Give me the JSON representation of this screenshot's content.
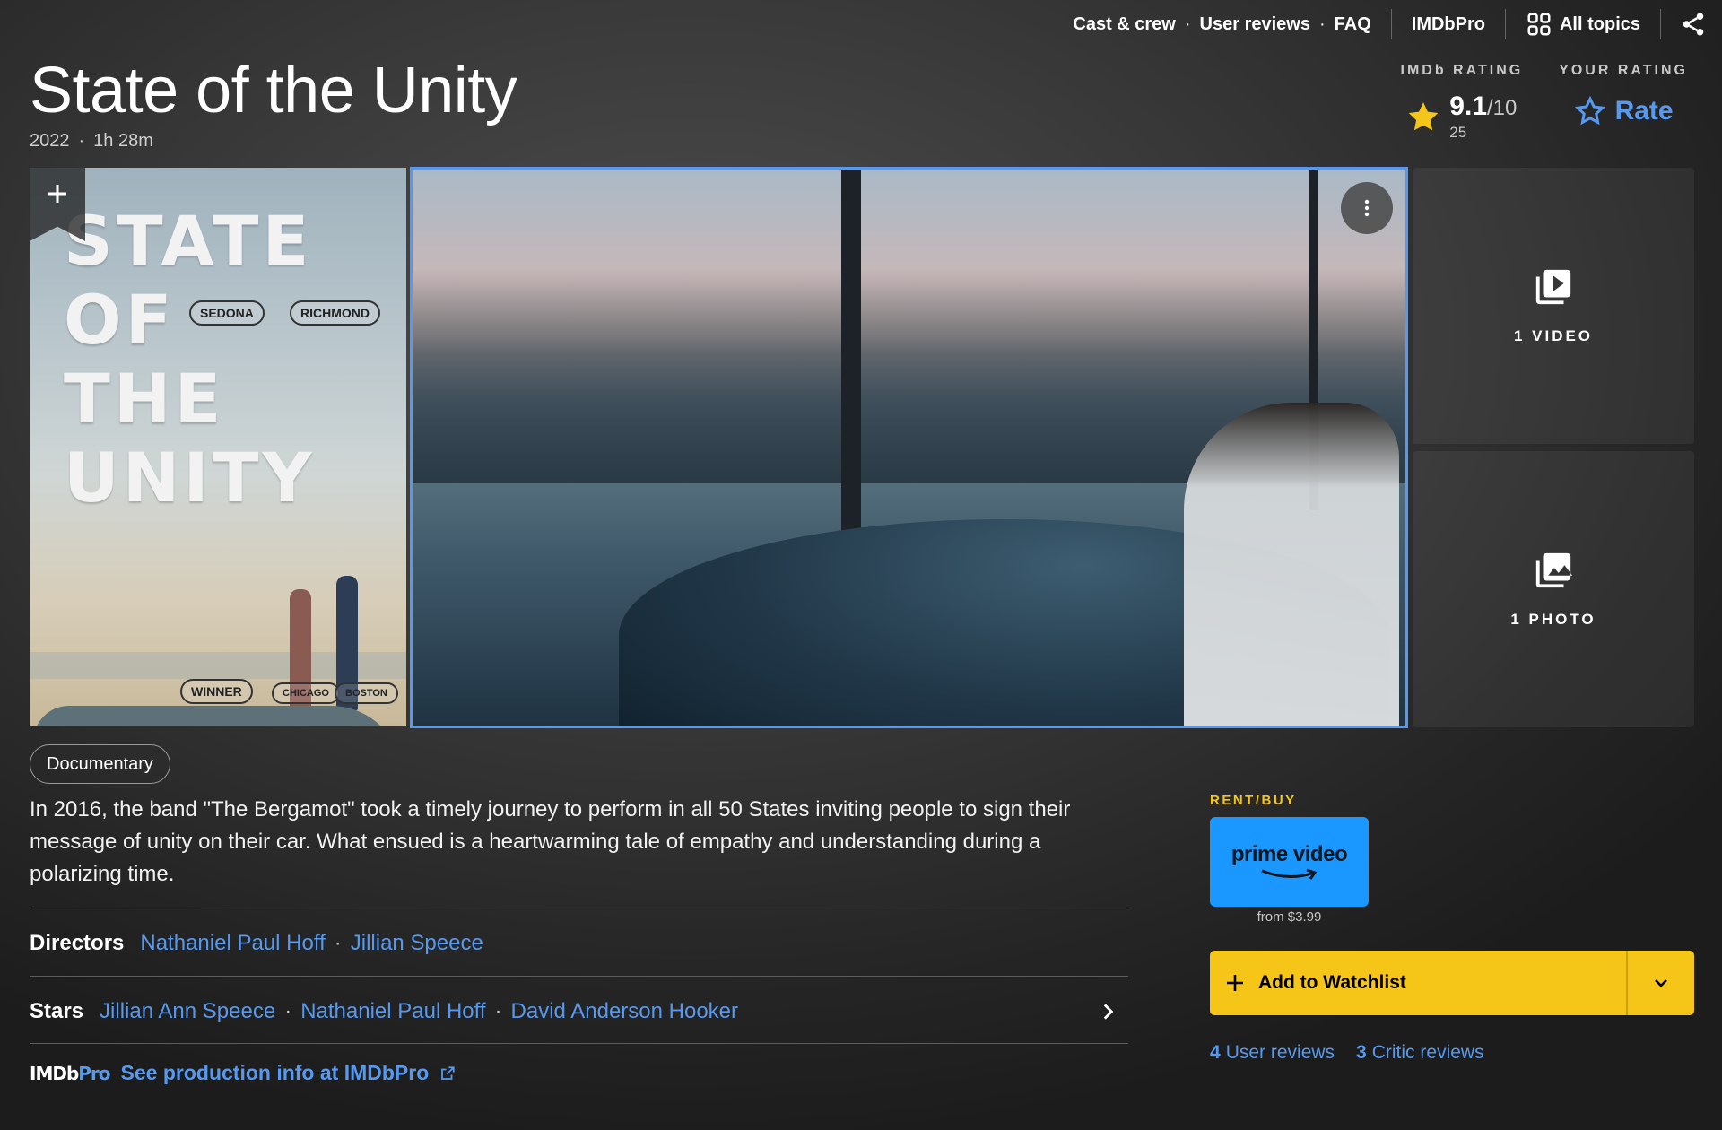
{
  "nav": {
    "cast_crew": "Cast & crew",
    "user_reviews": "User reviews",
    "faq": "FAQ",
    "imdbpro": "IMDbPro",
    "all_topics": "All topics"
  },
  "header": {
    "title": "State of the Unity",
    "year": "2022",
    "runtime": "1h 28m"
  },
  "ratings": {
    "imdb_label": "IMDb RATING",
    "score": "9.1",
    "out_of": "/10",
    "vote_count": "25",
    "your_label": "YOUR RATING",
    "rate_label": "Rate"
  },
  "poster": {
    "title_art": "STATE OF\nTHE\nUNITY",
    "laurel_1": "SEDONA",
    "laurel_2": "RICHMOND",
    "laurel_3": "WINNER",
    "laurel_4": "CHICAGO",
    "laurel_5": "BOSTON"
  },
  "tiles": {
    "videos": "1 VIDEO",
    "photos": "1 PHOTO"
  },
  "details": {
    "genre": "Documentary",
    "plot": "In 2016, the band \"The Bergamot\" took a timely journey to perform in all 50 States inviting people to sign their message of unity on their car. What ensued is a heartwarming tale of empathy and understanding during a polarizing time.",
    "directors_label": "Directors",
    "directors": [
      "Nathaniel Paul Hoff",
      "Jillian Speece"
    ],
    "stars_label": "Stars",
    "stars": [
      "Jillian Ann Speece",
      "Nathaniel Paul Hoff",
      "David Anderson Hooker"
    ],
    "pro_logo_a": "IMDb",
    "pro_logo_b": "Pro",
    "pro_link": "See production info at IMDbPro"
  },
  "sidebar": {
    "rent_label": "RENT/BUY",
    "provider": "prime video",
    "price": "from $3.99",
    "watchlist": "Add to Watchlist",
    "user_reviews_count": "4",
    "user_reviews_label": "User reviews",
    "critic_reviews_count": "3",
    "critic_reviews_label": "Critic reviews"
  },
  "colors": {
    "accent_yellow": "#f5c518",
    "link_blue": "#5799ef",
    "prime_blue": "#1a98ff"
  }
}
